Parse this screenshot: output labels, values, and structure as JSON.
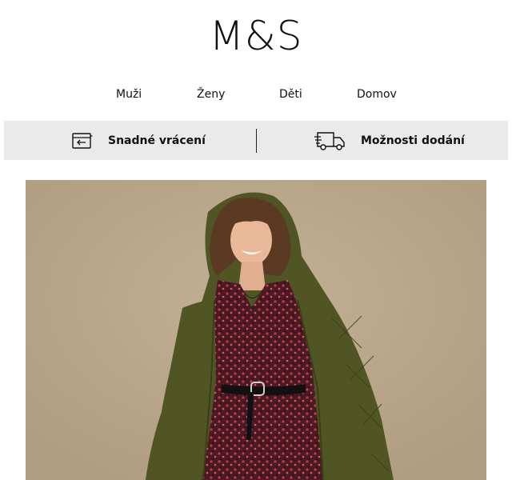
{
  "header": {
    "logo": "M&S"
  },
  "nav": {
    "items": [
      "Muži",
      "Ženy",
      "Děti",
      "Domov"
    ]
  },
  "promo": {
    "returns_label": "Snadné vrácení",
    "returns_icon": "return-box-icon",
    "delivery_label": "Možnosti dodání",
    "delivery_icon": "delivery-truck-icon"
  },
  "colors": {
    "promo_bar": "#eaeaea",
    "hero_background": "#baa78c",
    "coat": "#4f5523",
    "dress": "#5a1f2a"
  }
}
